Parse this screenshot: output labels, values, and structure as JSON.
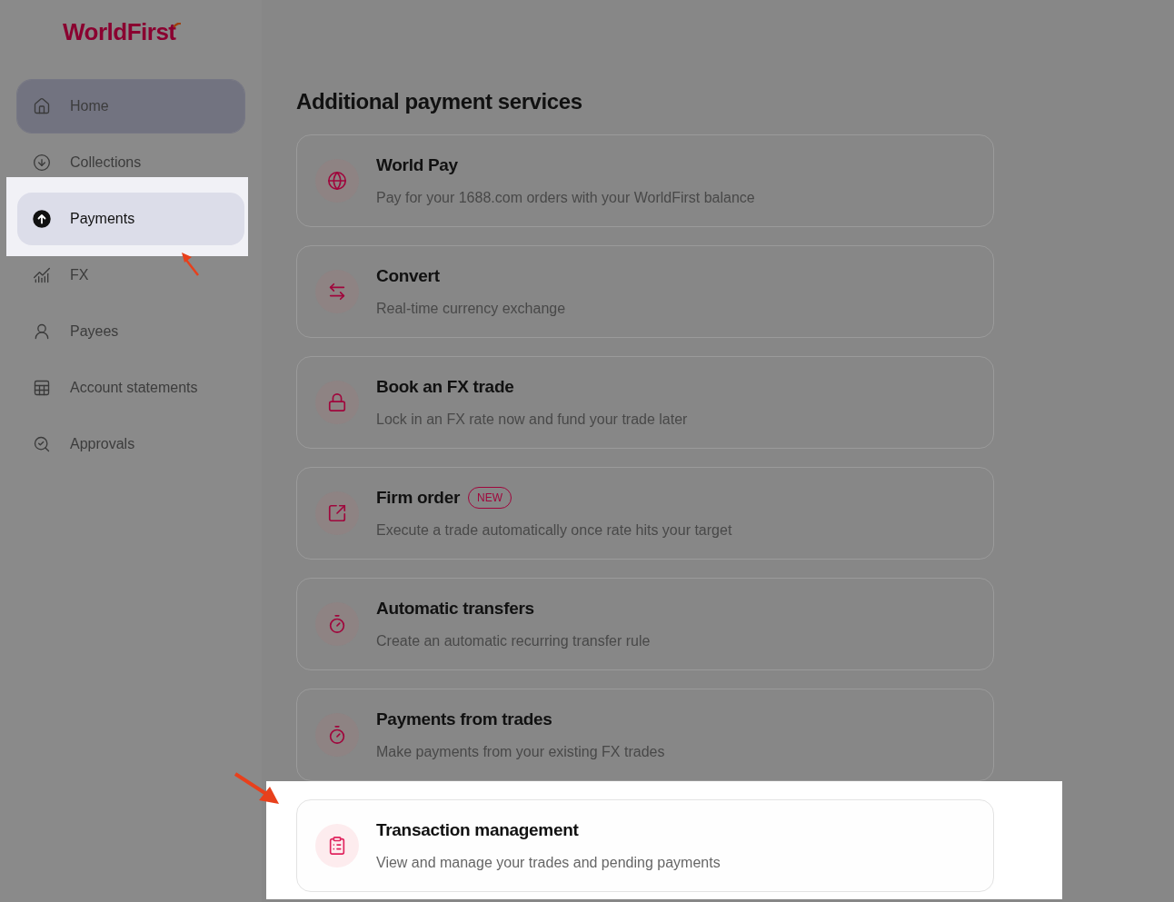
{
  "logo": {
    "text": "WorldFirst"
  },
  "sidebar": {
    "items": [
      {
        "label": "Home",
        "kind": "home",
        "selected": false,
        "hovered": true,
        "spotlit": false
      },
      {
        "label": "Collections",
        "kind": "collections",
        "selected": false,
        "hovered": false,
        "spotlit": false
      },
      {
        "label": "Payments",
        "kind": "payments",
        "selected": true,
        "hovered": false,
        "spotlit": true
      },
      {
        "label": "FX",
        "kind": "fx",
        "selected": false,
        "hovered": false,
        "spotlit": false
      },
      {
        "label": "Payees",
        "kind": "payees",
        "selected": false,
        "hovered": false,
        "spotlit": false
      },
      {
        "label": "Account statements",
        "kind": "statements",
        "selected": false,
        "hovered": false,
        "spotlit": false
      },
      {
        "label": "Approvals",
        "kind": "approvals",
        "selected": false,
        "hovered": false,
        "spotlit": false
      }
    ]
  },
  "main": {
    "title": "Additional payment services",
    "cards": [
      {
        "kind": "worldpay",
        "title": "World Pay",
        "description": "Pay for your 1688.com orders with your WorldFirst balance",
        "spotlit": false
      },
      {
        "kind": "convert",
        "title": "Convert",
        "description": "Real-time currency exchange",
        "spotlit": false
      },
      {
        "kind": "lock",
        "title": "Book an FX trade",
        "description": "Lock in an FX rate now and fund your trade later",
        "spotlit": false
      },
      {
        "kind": "chart",
        "title": "Firm order",
        "badge": "NEW",
        "description": "Execute a trade automatically once rate hits your target",
        "spotlit": false
      },
      {
        "kind": "timer",
        "title": "Automatic transfers",
        "description": "Create an automatic recurring transfer rule",
        "spotlit": false
      },
      {
        "kind": "timer",
        "title": "Payments from trades",
        "description": "Make payments from your existing FX trades",
        "spotlit": false
      },
      {
        "kind": "clipboard",
        "title": "Transaction management",
        "description": "View and manage your trades and pending payments",
        "spotlit": true
      }
    ]
  }
}
